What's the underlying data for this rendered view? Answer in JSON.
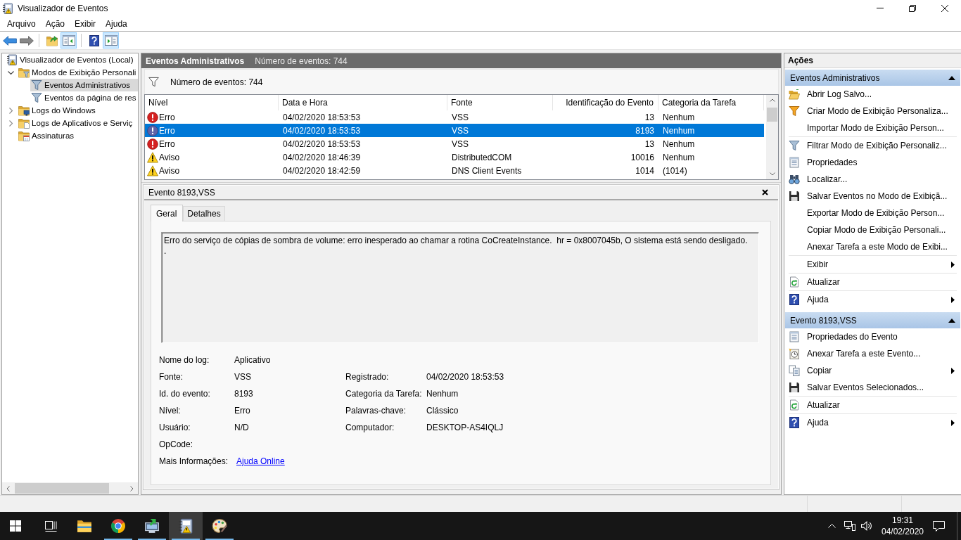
{
  "window": {
    "title": "Visualizador de Eventos"
  },
  "menu": [
    {
      "label": "Arquivo"
    },
    {
      "label": "Ação"
    },
    {
      "label": "Exibir"
    },
    {
      "label": "Ajuda"
    }
  ],
  "toolbar": [
    [
      {
        "kind": "back",
        "pressed": false,
        "disabled": false
      },
      {
        "kind": "forward",
        "pressed": false,
        "disabled": true
      }
    ],
    [
      {
        "kind": "up",
        "pressed": false,
        "disabled": false
      },
      {
        "kind": "tree",
        "pressed": true,
        "disabled": false
      }
    ],
    [
      {
        "kind": "help",
        "pressed": false,
        "disabled": false
      },
      {
        "kind": "actions",
        "pressed": true,
        "disabled": false
      }
    ]
  ],
  "tree": [
    {
      "label": "Visualizador de Eventos (Local)",
      "kind": "root",
      "selected": false,
      "children": [
        {
          "label": "Modos de Exibição Personali",
          "kind": "view-folder",
          "expanded": true,
          "selected": false,
          "children": [
            {
              "label": "Eventos Administrativos",
              "kind": "filter",
              "selected": true
            },
            {
              "label": "Eventos da página de res",
              "kind": "filter",
              "selected": false
            }
          ]
        },
        {
          "label": "Logs do Windows",
          "kind": "logs-folder",
          "expanded": false,
          "selected": false
        },
        {
          "label": "Logs de Aplicativos e Serviç",
          "kind": "apps-folder",
          "expanded": false,
          "selected": false
        },
        {
          "label": "Assinaturas",
          "kind": "subscriptions-folder",
          "selected": false
        }
      ]
    }
  ],
  "center": {
    "title": "Eventos Administrativos",
    "count": "Número de eventos: 744",
    "filter_text": "Número de eventos: 744",
    "table": {
      "columns": [
        "Nível",
        "Data e Hora",
        "Fonte",
        "Identificação do Evento",
        "Categoria da Tarefa"
      ],
      "rows": [
        {
          "kind": "error",
          "severity": "Erro",
          "date": "04/02/2020 18:53:53",
          "source": "VSS",
          "event_id": "13",
          "category": "Nenhum",
          "selected": false
        },
        {
          "kind": "error",
          "severity": "Erro",
          "date": "04/02/2020 18:53:53",
          "source": "VSS",
          "event_id": "8193",
          "category": "Nenhum",
          "selected": true
        },
        {
          "kind": "error",
          "severity": "Erro",
          "date": "04/02/2020 18:53:53",
          "source": "VSS",
          "event_id": "13",
          "category": "Nenhum",
          "selected": false
        },
        {
          "kind": "warning",
          "severity": "Aviso",
          "date": "04/02/2020 18:46:39",
          "source": "DistributedCOM",
          "event_id": "10016",
          "category": "Nenhum",
          "selected": false
        },
        {
          "kind": "warning",
          "severity": "Aviso",
          "date": "04/02/2020 18:42:59",
          "source": "DNS Client Events",
          "event_id": "1014",
          "category": "(1014)",
          "selected": false
        }
      ]
    }
  },
  "detail": {
    "title": "Evento 8193,VSS",
    "tabs": [
      {
        "label": "Geral",
        "selected": true
      },
      {
        "label": "Detalhes",
        "selected": false
      }
    ],
    "message": "Erro do serviço de cópias de sombra de volume: erro inesperado ao chamar a rotina CoCreateInstance.  hr = 0x8007045b, O sistema está sendo desligado.\n.",
    "fields": [
      {
        "label": "Nome do log:",
        "value": "Aplicativo"
      },
      {
        "label": "Fonte:",
        "value": "VSS",
        "right": {
          "label": "Registrado:",
          "value": "04/02/2020 18:53:53"
        }
      },
      {
        "label": "Id. do evento:",
        "value": "8193",
        "right": {
          "label": "Categoria da Tarefa:",
          "value": "Nenhum"
        }
      },
      {
        "label": "Nível:",
        "value": "Erro",
        "right": {
          "label": "Palavras-chave:",
          "value": "Clássico"
        }
      },
      {
        "label": "Usuário:",
        "value": "N/D",
        "right": {
          "label": "Computador:",
          "value": "DESKTOP-AS4IQLJ"
        }
      },
      {
        "label": "OpCode:"
      },
      {
        "label": "Mais Informações:",
        "link": "Ajuda Online"
      }
    ]
  },
  "actions": {
    "title": "Ações",
    "sections": [
      {
        "title": "Eventos Administrativos",
        "expanded": true,
        "groups": [
          [
            {
              "label": "Abrir Log Salvo...",
              "kind": "open-folder",
              "submenu": false
            },
            {
              "label": "Criar Modo de Exibição Personaliza...",
              "kind": "new-filter",
              "submenu": false
            },
            {
              "label": "Importar Modo de Exibição Person...",
              "kind": "none",
              "submenu": false
            }
          ],
          [
            {
              "label": "Filtrar Modo de Exibição Personaliz...",
              "kind": "filter",
              "submenu": false
            },
            {
              "label": "Propriedades",
              "kind": "properties",
              "submenu": false
            },
            {
              "label": "Localizar...",
              "kind": "find",
              "submenu": false
            },
            {
              "label": "Salvar Eventos no Modo de Exibiçã...",
              "kind": "save",
              "submenu": false
            },
            {
              "label": "Exportar Modo de Exibição Person...",
              "kind": "none",
              "submenu": false
            },
            {
              "label": "Copiar Modo de Exibição Personali...",
              "kind": "none",
              "submenu": false
            },
            {
              "label": "Anexar Tarefa a este Modo de Exibi...",
              "kind": "none",
              "submenu": false
            }
          ],
          [
            {
              "label": "Exibir",
              "kind": "none",
              "submenu": true
            }
          ],
          [
            {
              "label": "Atualizar",
              "kind": "refresh",
              "submenu": false
            }
          ],
          [
            {
              "label": "Ajuda",
              "kind": "help",
              "submenu": true
            }
          ]
        ]
      },
      {
        "title": "Evento 8193,VSS",
        "expanded": true,
        "groups": [
          [
            {
              "label": "Propriedades do Evento",
              "kind": "properties",
              "submenu": false
            },
            {
              "label": "Anexar Tarefa a este Evento...",
              "kind": "task",
              "submenu": false
            },
            {
              "label": "Copiar",
              "kind": "copy",
              "submenu": true
            },
            {
              "label": "Salvar Eventos Selecionados...",
              "kind": "save",
              "submenu": false
            }
          ],
          [
            {
              "label": "Atualizar",
              "kind": "refresh",
              "submenu": false
            }
          ],
          [
            {
              "label": "Ajuda",
              "kind": "help",
              "submenu": true
            }
          ]
        ]
      }
    ]
  },
  "taskbar": {
    "apps": [
      {
        "kind": "files",
        "running": false,
        "active": false
      },
      {
        "kind": "browser",
        "running": true,
        "active": false
      },
      {
        "kind": "monitor-arrow",
        "running": true,
        "active": false
      },
      {
        "kind": "log-book",
        "running": true,
        "active": true
      },
      {
        "kind": "palette",
        "running": true,
        "active": false
      }
    ],
    "time": "19:31",
    "date": "04/02/2020"
  }
}
